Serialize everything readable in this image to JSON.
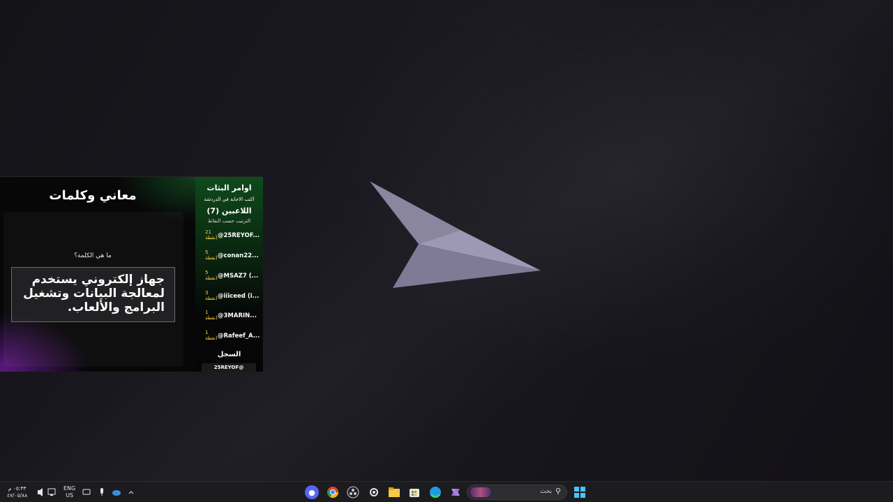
{
  "game": {
    "title": "معاني وكلمات",
    "question": "ما هي الكلمة؟",
    "definition": "جهاز إلكتروني يستخدم لمعالجة البيانات وتشغيل البرامج والألعاب."
  },
  "sidebar": {
    "title": "اوامر البثات",
    "subtitle": "اكتب الاجابة في الدردشة",
    "players_label": "اللاعبين (7)",
    "sort_label": "الترتيب حسب النقاط",
    "players": [
      {
        "name": "@25REYOF...",
        "points": "21",
        "unit": "نقطة)"
      },
      {
        "name": "@conan22...",
        "points": "5",
        "unit": "نقطة)"
      },
      {
        "name": "@MSAZ7 (...",
        "points": "5",
        "unit": "نقطة)"
      },
      {
        "name": "@iiiceed (i...",
        "points": "3",
        "unit": "نقطة)"
      },
      {
        "name": "@3MARIN...",
        "points": "1",
        "unit": "نقطة)"
      },
      {
        "name": "@Rafeef_A...",
        "points": "1",
        "unit": "نقطة)"
      }
    ],
    "log_label": "السجل",
    "log_entry": "25REYOF@"
  },
  "taskbar": {
    "search_placeholder": "بحث",
    "language": "ENG",
    "region": "US",
    "time": "٠٥:٣٣ م",
    "date": "٤٧/٠٥/٨٨"
  },
  "colors": {
    "accent_green": "#0f4a1b",
    "accent_purple": "#781eaa",
    "points_yellow": "#ffd54a"
  }
}
